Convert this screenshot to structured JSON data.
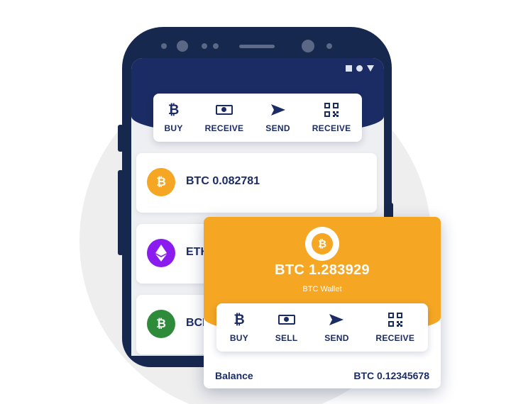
{
  "colors": {
    "navy": "#1b2c64",
    "bitcoin_orange": "#f5a623",
    "ether_purple": "#8b1cf0",
    "bch_green": "#2e8b3a"
  },
  "phone": {
    "status_icons": [
      "square-icon",
      "circle-icon",
      "triangle-icon"
    ],
    "actions": [
      {
        "label": "BUY",
        "icon": "bitcoin-icon"
      },
      {
        "label": "RECEIVE",
        "icon": "cash-icon"
      },
      {
        "label": "SEND",
        "icon": "send-icon"
      },
      {
        "label": "RECEIVE",
        "icon": "qr-code-icon"
      }
    ],
    "wallets": [
      {
        "text": "BTC 0.082781",
        "icon": "bitcoin-icon"
      },
      {
        "text": "ETH",
        "icon": "ethereum-icon"
      },
      {
        "text": "BCH",
        "icon": "bitcoin-cash-icon"
      }
    ]
  },
  "card": {
    "amount": "BTC 1.283929",
    "subtitle": "BTC Wallet",
    "actions": [
      {
        "label": "BUY",
        "icon": "bitcoin-icon"
      },
      {
        "label": "SELL",
        "icon": "cash-icon"
      },
      {
        "label": "SEND",
        "icon": "send-icon"
      },
      {
        "label": "RECEIVE",
        "icon": "qr-code-icon"
      }
    ],
    "balance_label": "Balance",
    "balance_value": "BTC 0.12345678"
  }
}
